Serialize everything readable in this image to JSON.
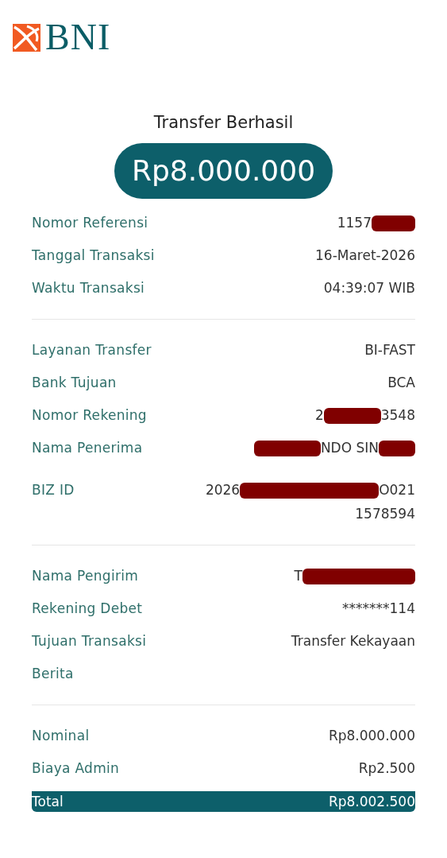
{
  "header": {
    "logo_text": "BNI"
  },
  "title": "Transfer Berhasil",
  "amount": "Rp8.000.000",
  "sections": [
    {
      "rows": [
        {
          "label": "Nomor Referensi",
          "value": [
            {
              "kind": "text",
              "text": "1157"
            },
            {
              "kind": "redaction"
            }
          ]
        },
        {
          "label": "Tanggal Transaksi",
          "value": [
            {
              "kind": "text",
              "text": "16-Maret-2026"
            }
          ]
        },
        {
          "label": "Waktu Transaksi",
          "value": [
            {
              "kind": "text",
              "text": "04:39:07 WIB"
            }
          ]
        }
      ]
    },
    {
      "rows": [
        {
          "label": "Layanan Transfer",
          "value": [
            {
              "kind": "text",
              "text": "BI-FAST"
            }
          ]
        },
        {
          "label": "Bank Tujuan",
          "value": [
            {
              "kind": "text",
              "text": "BCA"
            }
          ]
        },
        {
          "label": "Nomor Rekening",
          "value": [
            {
              "kind": "text",
              "text": "2"
            },
            {
              "kind": "redaction"
            },
            {
              "kind": "text",
              "text": "3548"
            }
          ]
        },
        {
          "label": "Nama Penerima",
          "value": [
            {
              "kind": "redaction"
            },
            {
              "kind": "text",
              "text": "NDO SIN"
            },
            {
              "kind": "redaction"
            }
          ]
        },
        {
          "label": "BIZ ID",
          "value": [
            {
              "kind": "text",
              "text": "2026"
            },
            {
              "kind": "redaction"
            },
            {
              "kind": "text",
              "text": "O021"
            },
            {
              "kind": "break"
            },
            {
              "kind": "text",
              "text": "1578594"
            }
          ]
        }
      ]
    },
    {
      "rows": [
        {
          "label": "Nama Pengirim",
          "value": [
            {
              "kind": "text",
              "text": "T"
            },
            {
              "kind": "redaction"
            }
          ]
        },
        {
          "label": "Rekening Debet",
          "value": [
            {
              "kind": "text",
              "text": "*******114"
            }
          ]
        },
        {
          "label": "Tujuan Transaksi",
          "value": [
            {
              "kind": "text",
              "text": "Transfer Kekayaan"
            }
          ]
        },
        {
          "label": "Berita",
          "value": []
        }
      ]
    },
    {
      "rows": [
        {
          "label": "Nominal",
          "value": [
            {
              "kind": "text",
              "text": "Rp8.000.000"
            }
          ]
        },
        {
          "label": "Biaya Admin",
          "value": [
            {
              "kind": "text",
              "text": "Rp2.500"
            }
          ]
        }
      ]
    }
  ],
  "total": {
    "label": "Total",
    "value": "Rp8.002.500"
  }
}
